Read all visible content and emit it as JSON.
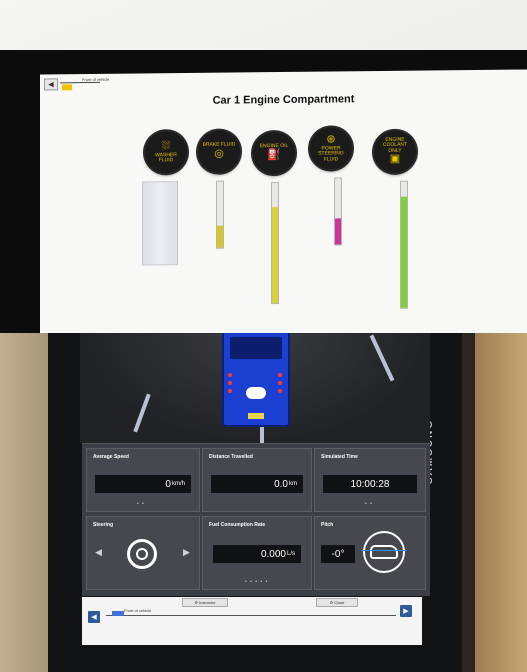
{
  "top_screen": {
    "nav_label": "Front of vehicle",
    "title": "Car 1 Engine Compartment",
    "caps": [
      {
        "id": "washer",
        "label": "WASHER FLUID",
        "icon": "washer-fluid-icon",
        "glyph": "⛆"
      },
      {
        "id": "brake",
        "label": "BRAKE FLUID",
        "icon": "brake-fluid-icon",
        "glyph": "◎"
      },
      {
        "id": "oil",
        "label": "ENGINE OIL",
        "icon": "oil-can-icon",
        "glyph": "⛽"
      },
      {
        "id": "steering",
        "label": "POWER STEERING FLUID",
        "icon": "steering-wheel-icon",
        "glyph": "⊛"
      },
      {
        "id": "coolant",
        "label": "ENGINE COOLANT ONLY",
        "icon": "coolant-icon",
        "glyph": "▣"
      }
    ],
    "colors": {
      "cap_text": "#e6c200",
      "oil_fill": "#d8d23a",
      "brake_fill": "#d7c62b",
      "steering_fill": "#d0349a",
      "coolant_fill": "#7fcf3a"
    }
  },
  "dashboard": {
    "brand": "SAMSUNG",
    "average_speed": {
      "title": "Average Speed",
      "value": "0",
      "unit": "km/h"
    },
    "distance": {
      "title": "Distance Travelled",
      "value": "0.0",
      "unit": "km"
    },
    "sim_time": {
      "title": "Simulated Time",
      "value": "10:00:28"
    },
    "steering": {
      "title": "Steering"
    },
    "fuel": {
      "title": "Fuel Consumption Rate",
      "value": "0.000",
      "unit": "L/s"
    },
    "pitch": {
      "title": "Pitch",
      "value": "-0°"
    },
    "dots_a": "• •",
    "dots_b": "• • • • •",
    "dots_c": "• •"
  },
  "bottom_nav": {
    "label": "Front of vehicle",
    "tab_left": "⚙ Instructor",
    "tab_right": "⚙ Close"
  }
}
